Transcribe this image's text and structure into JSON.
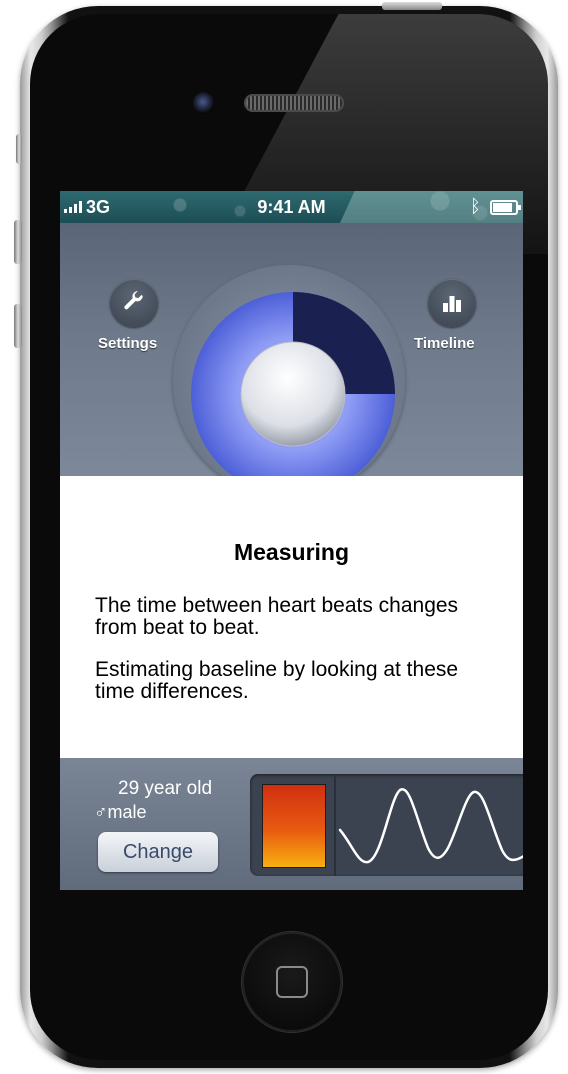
{
  "status_bar": {
    "network": "3G",
    "time": "9:41 AM"
  },
  "nav": {
    "settings_label": "Settings",
    "timeline_label": "Timeline"
  },
  "progress": {
    "fraction_complete": 0.25
  },
  "content": {
    "title": "Measuring",
    "paragraph1": "The time between heart beats changes from beat to beat.",
    "paragraph2": "Estimating baseline by looking at these time differences."
  },
  "profile": {
    "age": "29 year old",
    "gender_symbol": "♂",
    "gender": "male",
    "change_label": "Change"
  },
  "colors": {
    "dial_blue": "#5a6ee0",
    "dial_navy": "#1a2050",
    "background_blue_gray": "#6e7a8b",
    "preview_orange": "#e85a10"
  }
}
